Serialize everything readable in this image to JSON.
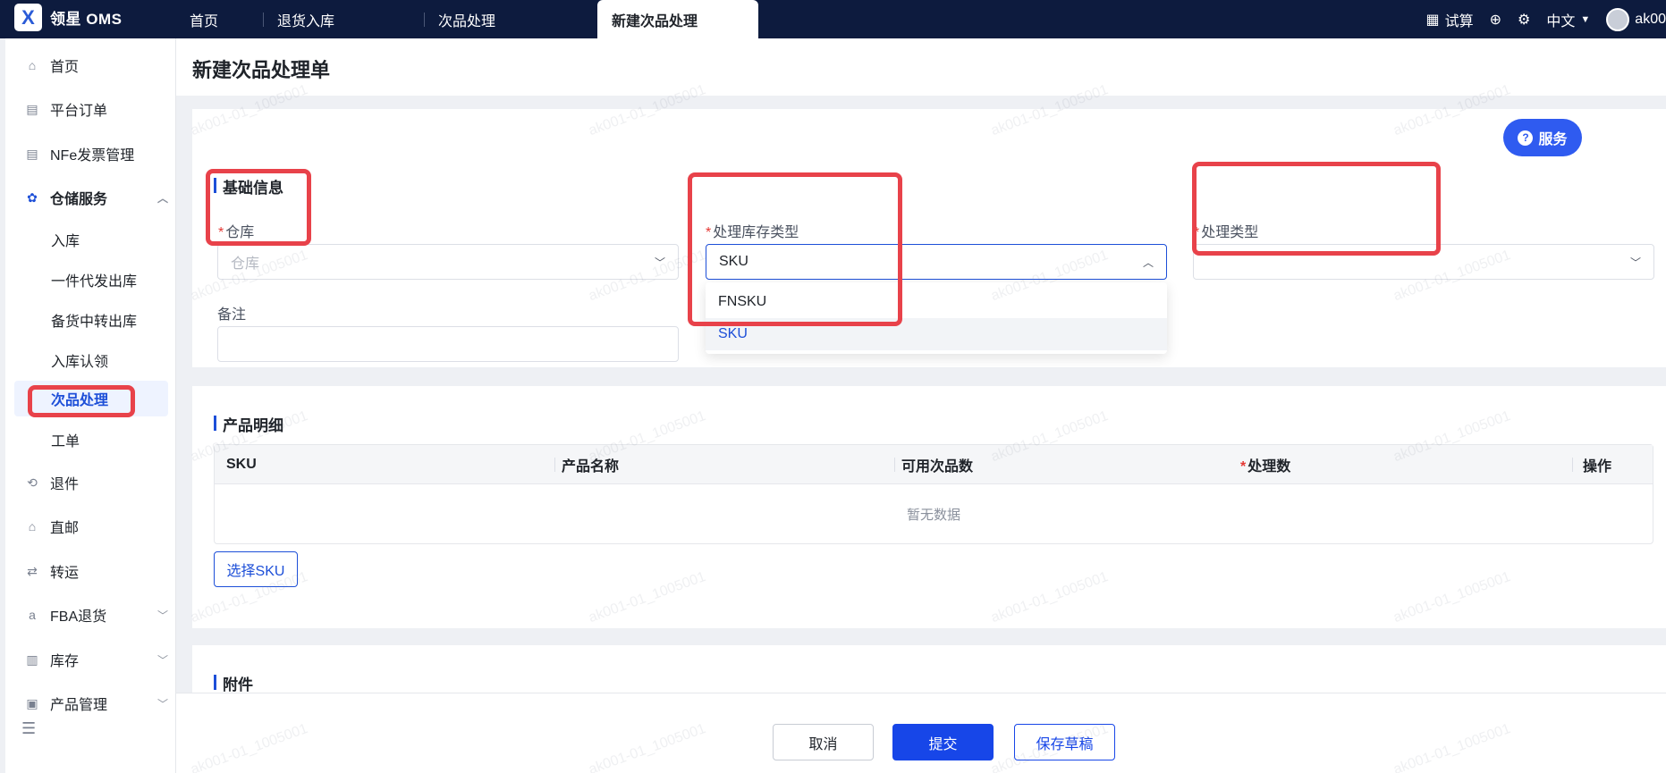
{
  "app": {
    "logo_text": "领星 OMS"
  },
  "tabs": [
    {
      "label": "首页"
    },
    {
      "label": "退货入库"
    },
    {
      "label": "次品处理"
    },
    {
      "label": "新建次品处理"
    }
  ],
  "topright": {
    "trial_label": "试算",
    "language": "中文",
    "user": "ak00"
  },
  "sidebar": {
    "items": [
      {
        "label": "首页"
      },
      {
        "label": "平台订单"
      },
      {
        "label": "NFe发票管理"
      },
      {
        "label": "仓储服务"
      },
      {
        "label": "退件"
      },
      {
        "label": "直邮"
      },
      {
        "label": "转运"
      },
      {
        "label": "FBA退货"
      },
      {
        "label": "库存"
      },
      {
        "label": "产品管理"
      }
    ],
    "sub_items": [
      {
        "label": "入库"
      },
      {
        "label": "一件代发出库"
      },
      {
        "label": "备货中转出库"
      },
      {
        "label": "入库认领"
      },
      {
        "label": "次品处理"
      },
      {
        "label": "工单"
      }
    ]
  },
  "page": {
    "title": "新建次品处理单"
  },
  "basic_info": {
    "title": "基础信息",
    "warehouse_label": "仓库",
    "warehouse_placeholder": "仓库",
    "stock_type_label": "处理库存类型",
    "stock_type_value": "SKU",
    "process_type_label": "处理类型",
    "remark_label": "备注",
    "dropdown_options": [
      "FNSKU",
      "SKU"
    ]
  },
  "service_button": "服务",
  "product_detail": {
    "title": "产品明细",
    "columns": [
      "SKU",
      "产品名称",
      "可用次品数",
      "处理数",
      "操作"
    ],
    "empty_text": "暂无数据",
    "select_sku_label": "选择SKU"
  },
  "attachment": {
    "title": "附件"
  },
  "footer": {
    "cancel": "取消",
    "submit": "提交",
    "draft": "保存草稿"
  },
  "watermark_text": "ak001-01_1005001"
}
